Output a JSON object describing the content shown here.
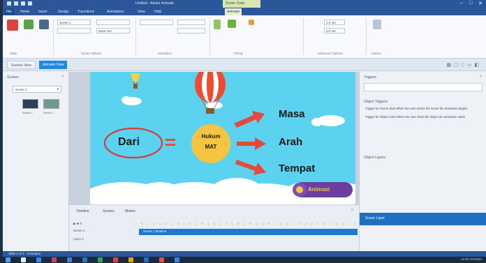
{
  "window": {
    "title": "Untitled - Adobe Animate",
    "context_tab": "Scene Tools"
  },
  "ribbon": {
    "tabs": [
      "File",
      "Home",
      "Insert",
      "Design",
      "Transitions",
      "Animations",
      "View",
      "Help",
      "Animate"
    ],
    "active_tab": "Animate",
    "groups": [
      "Slide",
      "Scene Options",
      "Animation",
      "Timing",
      "Advanced Options",
      "Motion"
    ],
    "fields": {
      "scene_name": "Scene 1",
      "duration": "2.5 sec",
      "delay": "0.0 sec",
      "easing": "Ease Out"
    }
  },
  "subbar": {
    "tabs": [
      "Scenes View",
      "Animate View"
    ],
    "active_index": 1
  },
  "scenes_panel": {
    "title": "Scenes",
    "select_value": "Scene 1",
    "thumb_labels": [
      "Scene 1",
      "Scene 2"
    ]
  },
  "slide": {
    "main_label": "Dari",
    "center_line1": "Hukum",
    "center_line2": "MAT",
    "targets": [
      "Masa",
      "Arah",
      "Tempat"
    ],
    "logo_text": "Animasi"
  },
  "timeline": {
    "tabs": [
      "Timeline",
      "Scenes",
      "Motion"
    ],
    "track_label": "Scene 1 timeline",
    "rows": [
      "Scene 1",
      "Layer 1"
    ]
  },
  "right_panel": {
    "title": "Triggers",
    "object_triggers_title": "Object Triggers",
    "trigger_items": [
      "Trigger for Scene Start  When the user enters the scene the animation begins",
      "Trigger for Object Click  When the user clicks the object the animation starts"
    ],
    "layers_title": "Object Layers",
    "footer_label": "Scene Layer"
  },
  "statusbar": {
    "text": "Slide 1 of 1 · Animation"
  },
  "taskbar": {
    "time": "12:00",
    "date": "1/1/2024"
  },
  "colors": {
    "ribbon_blue": "#2b579a",
    "slide_sky": "#5ad2f0",
    "accent_red": "#d93a3a",
    "circle_yellow": "#f5c542",
    "timeline_track": "#1e78cf"
  }
}
